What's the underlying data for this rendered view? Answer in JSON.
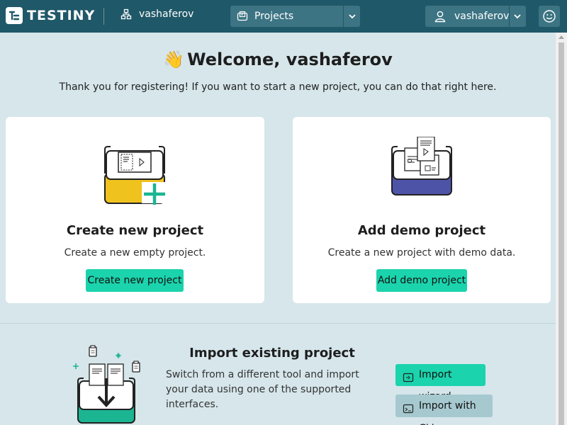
{
  "topbar": {
    "logo_text": "TESTINY",
    "org_name": "vashaferov",
    "project_select_label": "Projects",
    "user_select_label": "vashaferov"
  },
  "welcome": {
    "title": "Welcome, vashaferov",
    "emoji": "👋",
    "subtitle": "Thank you for registering! If you want to start a new project, you can do that right here."
  },
  "cards": {
    "create": {
      "title": "Create new project",
      "description": "Create a new empty project.",
      "button": "Create new project"
    },
    "demo": {
      "title": "Add demo project",
      "description": "Create a new project with demo data.",
      "button": "Add demo project"
    }
  },
  "import": {
    "title": "Import existing project",
    "description": "Switch from a different tool and import your data using one of the supported interfaces.",
    "wizard_button": "Import wizard",
    "cli_button": "Import with CLI"
  },
  "colors": {
    "topbar": "#1f5868",
    "accent": "#1bd3ac",
    "background": "#d6e6eb",
    "secondary_button": "#a6c9d0"
  }
}
